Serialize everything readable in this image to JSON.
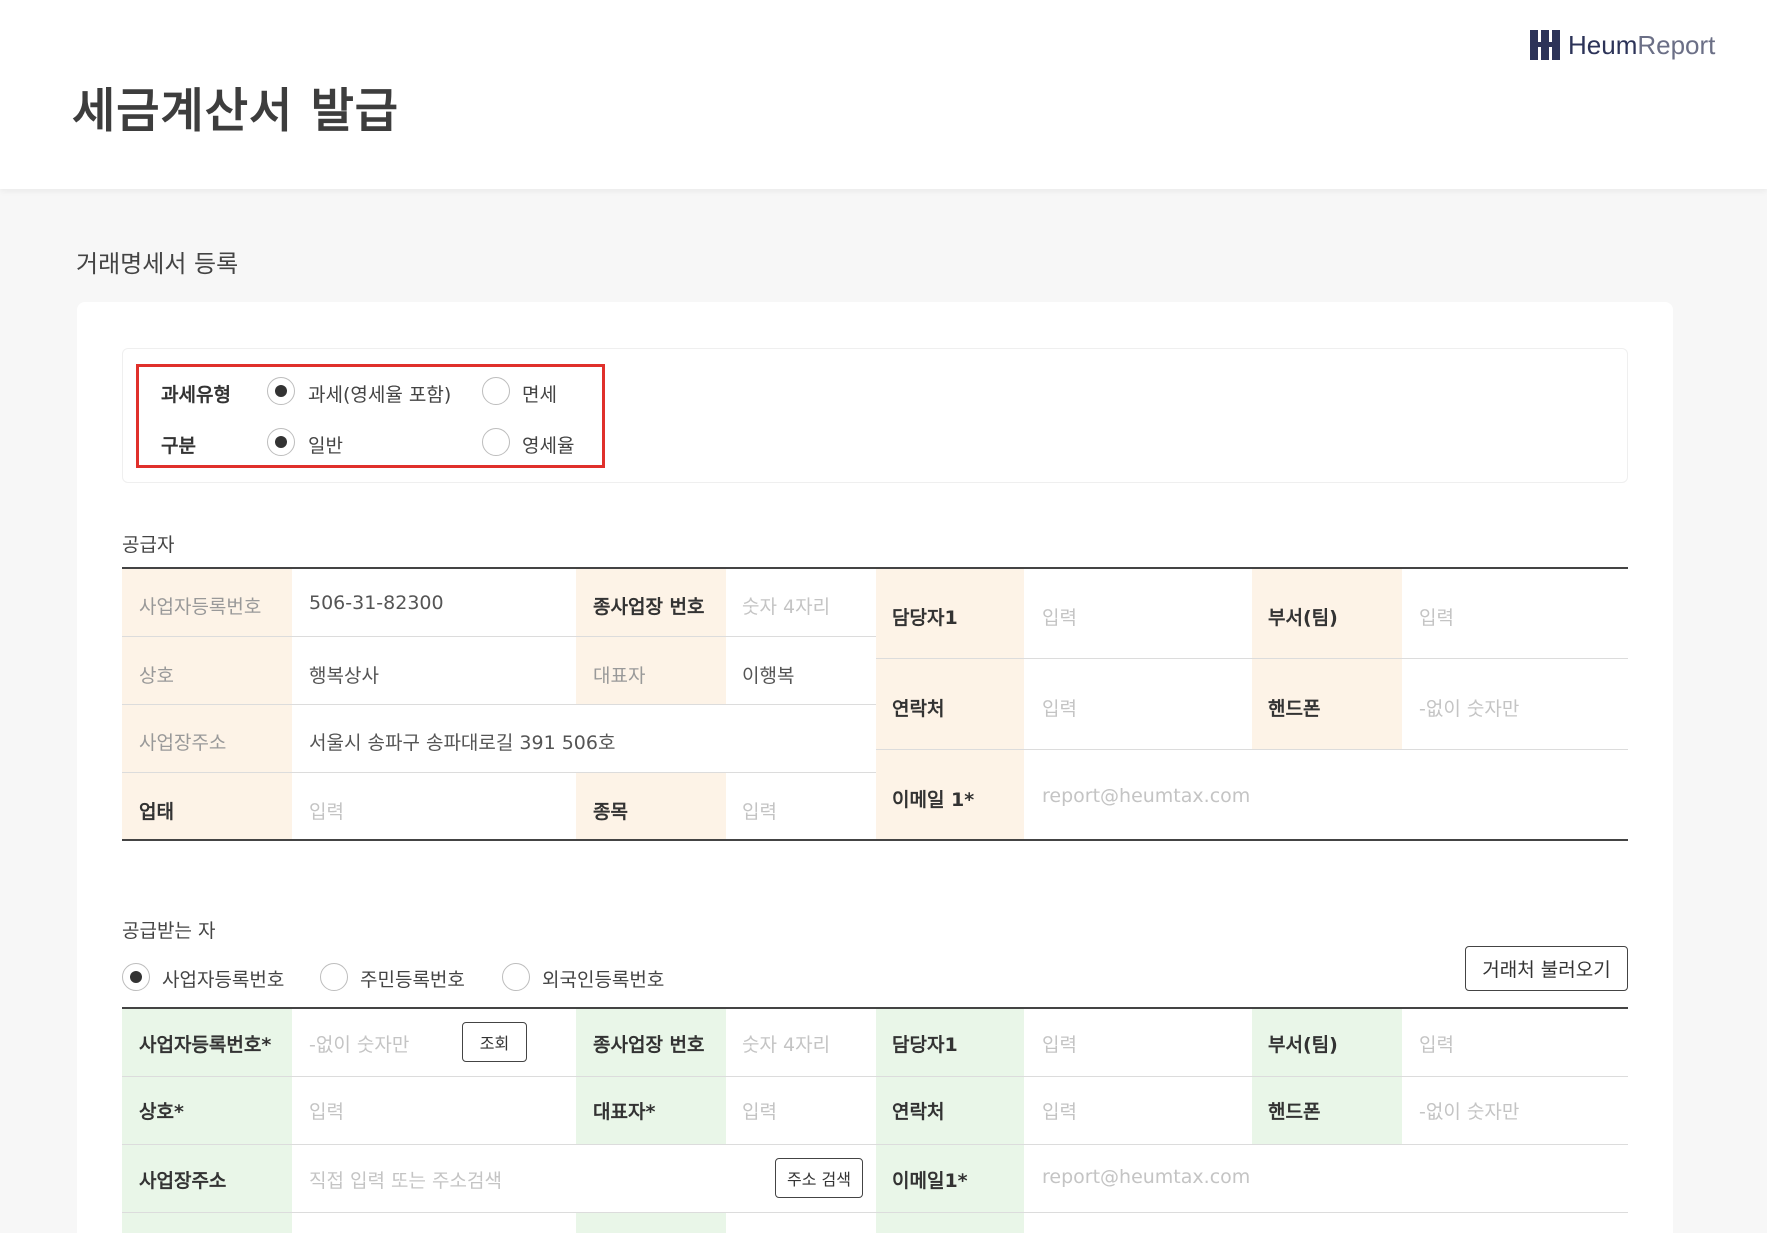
{
  "header": {
    "title": "세금계산서 발급",
    "logo_strong": "Heum",
    "logo_light": "Report"
  },
  "section_title": "거래명세서 등록",
  "tax_type": {
    "label": "과세유형",
    "options": [
      "과세(영세율 포함)",
      "면세"
    ],
    "selected": "과세(영세율 포함)"
  },
  "category": {
    "label": "구분",
    "options": [
      "일반",
      "영세율"
    ],
    "selected": "일반"
  },
  "supplier": {
    "title": "공급자",
    "left": {
      "biz_no_label": "사업자등록번호",
      "biz_no_value": "506-31-82300",
      "branch_label": "종사업장 번호",
      "branch_placeholder": "숫자 4자리",
      "name_label": "상호",
      "name_value": "행복상사",
      "ceo_label": "대표자",
      "ceo_value": "이행복",
      "address_label": "사업장주소",
      "address_value": "서울시 송파구 송파대로길 391 506호",
      "biz_type_label": "업태",
      "biz_type_placeholder": "입력",
      "biz_item_label": "종목",
      "biz_item_placeholder": "입력"
    },
    "right": {
      "manager_label": "담당자1",
      "manager_placeholder": "입력",
      "dept_label": "부서(팀)",
      "dept_placeholder": "입력",
      "contact_label": "연락처",
      "contact_placeholder": "입력",
      "phone_label": "핸드폰",
      "phone_placeholder": "-없이 숫자만",
      "email_label": "이메일 1*",
      "email_placeholder": "report@heumtax.com"
    }
  },
  "receiver": {
    "title": "공급받는 자",
    "id_types": [
      "사업자등록번호",
      "주민등록번호",
      "외국인등록번호"
    ],
    "id_selected": "사업자등록번호",
    "load_button": "거래처 불러오기",
    "left": {
      "biz_no_label": "사업자등록번호*",
      "biz_no_placeholder": "-없이 숫자만",
      "lookup_button": "조회",
      "branch_label": "종사업장 번호",
      "branch_placeholder": "숫자 4자리",
      "name_label": "상호*",
      "name_placeholder": "입력",
      "ceo_label": "대표자*",
      "ceo_placeholder": "입력",
      "address_label": "사업장주소",
      "address_placeholder": "직접 입력 또는 주소검색",
      "address_button": "주소 검색"
    },
    "right": {
      "manager_label": "담당자1",
      "manager_placeholder": "입력",
      "dept_label": "부서(팀)",
      "dept_placeholder": "입력",
      "contact_label": "연락처",
      "contact_placeholder": "입력",
      "phone_label": "핸드폰",
      "phone_placeholder": "-없이 숫자만",
      "email_label": "이메일1*",
      "email_placeholder": "report@heumtax.com"
    }
  },
  "colors": {
    "supplier_label_bg": "#fdf3e7",
    "receiver_label_bg": "#e9f6e8",
    "highlight_border": "#e0302b",
    "brand": "#2c3358"
  }
}
